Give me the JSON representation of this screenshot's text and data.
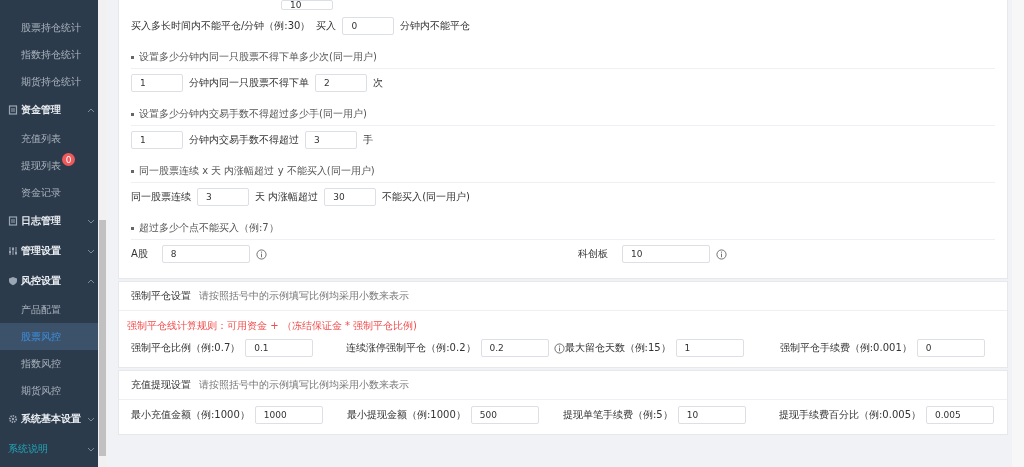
{
  "sidebar": {
    "items": [
      {
        "kind": "sub",
        "label": "股票持仓统计",
        "selected": false
      },
      {
        "kind": "sub",
        "label": "指数持仓统计",
        "selected": false
      },
      {
        "kind": "sub",
        "label": "期货持仓统计",
        "selected": false
      },
      {
        "kind": "group",
        "label": "资金管理",
        "expanded": true,
        "accent": false
      },
      {
        "kind": "sub",
        "label": "充值列表",
        "selected": false
      },
      {
        "kind": "sub",
        "label": "提现列表",
        "selected": false,
        "badge": "0"
      },
      {
        "kind": "sub",
        "label": "资金记录",
        "selected": false
      },
      {
        "kind": "group",
        "label": "日志管理",
        "expanded": false,
        "accent": false
      },
      {
        "kind": "group",
        "label": "管理设置",
        "expanded": false,
        "accent": false
      },
      {
        "kind": "group",
        "label": "风控设置",
        "expanded": true,
        "accent": false
      },
      {
        "kind": "sub",
        "label": "产品配置",
        "selected": false
      },
      {
        "kind": "sub",
        "label": "股票风控",
        "selected": true
      },
      {
        "kind": "sub",
        "label": "指数风控",
        "selected": false
      },
      {
        "kind": "sub",
        "label": "期货风控",
        "selected": false
      },
      {
        "kind": "group",
        "label": "系统基本设置",
        "expanded": false,
        "accent": false
      },
      {
        "kind": "group",
        "label": "系统说明",
        "expanded": false,
        "accent": true
      }
    ]
  },
  "top_field": {
    "value": "10"
  },
  "rules": [
    {
      "columns": [
        [
          {
            "kind": "text",
            "text": "买入多长时间内不能平仓/分钟（例:30）"
          },
          {
            "kind": "text",
            "text": "买入"
          },
          {
            "kind": "input",
            "value": "0"
          },
          {
            "kind": "text",
            "text": "分钟内不能平仓"
          }
        ]
      ]
    },
    {
      "heading": "设置多少分钟内同一只股票不得下单多少次(同一用户)",
      "columns": [
        [
          {
            "kind": "input",
            "value": "1"
          },
          {
            "kind": "text",
            "text": "分钟内同一只股票不得下单"
          },
          {
            "kind": "input",
            "value": "2"
          },
          {
            "kind": "text",
            "text": "次"
          }
        ]
      ]
    },
    {
      "heading": "设置多少分钟内交易手数不得超过多少手(同一用户)",
      "columns": [
        [
          {
            "kind": "input",
            "value": "1"
          },
          {
            "kind": "text",
            "text": "分钟内交易手数不得超过"
          },
          {
            "kind": "input",
            "value": "3"
          },
          {
            "kind": "text",
            "text": "手"
          }
        ]
      ]
    },
    {
      "heading": "同一股票连续 x 天 内涨幅超过 y 不能买入(同一用户)",
      "columns": [
        [
          {
            "kind": "text",
            "text": "同一股票连续"
          },
          {
            "kind": "input",
            "value": "3"
          },
          {
            "kind": "text",
            "text": "天 内涨幅超过"
          },
          {
            "kind": "input",
            "value": "30"
          },
          {
            "kind": "text",
            "text": "不能买入(同一用户)"
          }
        ]
      ]
    },
    {
      "heading": "超过多少个点不能买入（例:7）",
      "columns": [
        [
          {
            "kind": "text",
            "text": "A股"
          },
          {
            "kind": "wide-input",
            "value": "8"
          },
          {
            "kind": "info"
          }
        ],
        [
          {
            "kind": "text",
            "text": "科创板"
          },
          {
            "kind": "wide-input",
            "value": "10"
          },
          {
            "kind": "info"
          }
        ]
      ]
    }
  ],
  "sections": [
    {
      "title": "强制平仓设置",
      "hint": "请按照括号中的示例填写比例均采用小数来表示",
      "note": "强制平仓线计算规则：可用资金 + （冻结保证金 * 强制平仓比例)",
      "fields": [
        {
          "label": "强制平仓比例（例:0.7）",
          "value": "0.1",
          "info": false
        },
        {
          "label": "连续涨停强制平仓（例:0.2）",
          "value": "0.2",
          "info": true
        },
        {
          "label": "最大留仓天数（例:15）",
          "value": "1",
          "info": false
        },
        {
          "label": "强制平仓手续费（例:0.001）",
          "value": "0",
          "info": false
        }
      ]
    },
    {
      "title": "充值提现设置",
      "hint": "请按照括号中的示例填写比例均采用小数来表示",
      "fields": [
        {
          "label": "最小充值金额（例:1000）",
          "value": "1000",
          "info": false
        },
        {
          "label": "最小提现金额（例:1000）",
          "value": "500",
          "info": false
        },
        {
          "label": "提现单笔手续费（例:5）",
          "value": "10",
          "info": false
        },
        {
          "label": "提现手续费百分比（例:0.005）",
          "value": "0.005",
          "info": false
        }
      ]
    }
  ]
}
